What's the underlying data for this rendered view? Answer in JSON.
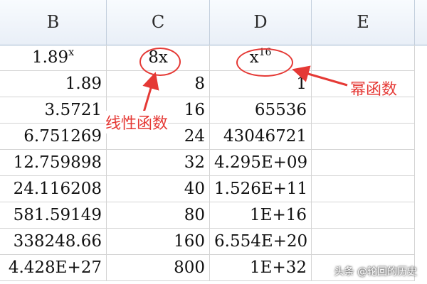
{
  "columns": [
    "B",
    "C",
    "D",
    "E"
  ],
  "header_row": {
    "b_base": "1.89",
    "b_exp": "x",
    "c": "8x",
    "d_base": "x",
    "d_exp": "16"
  },
  "rows": [
    {
      "b": "1.89",
      "c": "8",
      "d": "1"
    },
    {
      "b": "3.5721",
      "c": "16",
      "d": "65536"
    },
    {
      "b": "6.751269",
      "c": "24",
      "d": "43046721"
    },
    {
      "b": "12.759898",
      "c": "32",
      "d": "4.295E+09"
    },
    {
      "b": "24.116208",
      "c": "40",
      "d": "1.526E+11"
    },
    {
      "b": "581.59149",
      "c": "80",
      "d": "1E+16"
    },
    {
      "b": "338248.66",
      "c": "160",
      "d": "6.554E+20"
    },
    {
      "b": "4.428E+27",
      "c": "800",
      "d": "1E+32"
    }
  ],
  "annotations": {
    "linear": "线性函数",
    "power": "幂函数"
  },
  "watermark": "头条 @轮回的历史",
  "colors": {
    "annotation": "#e53935",
    "grid": "#d4d4d4",
    "header_bg": "#e9eff7"
  }
}
